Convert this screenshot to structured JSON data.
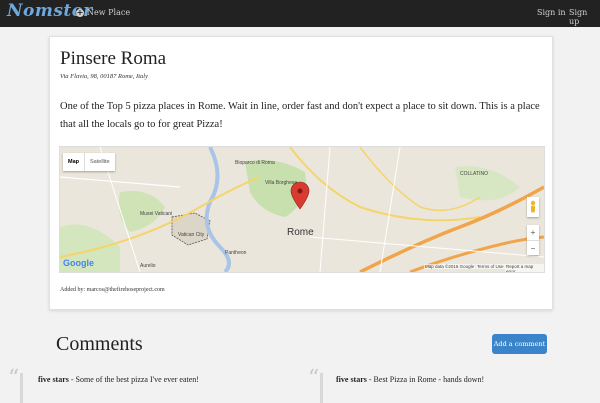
{
  "navbar": {
    "brand": "Nomster",
    "new_place": "New Place",
    "sign_in": "Sign in",
    "sign_up": "Sign up"
  },
  "place": {
    "name": "Pinsere Roma",
    "address": "Via Flavia, 98, 00187 Rome, Italy",
    "description": "One of the Top 5 pizza places in Rome. Wait in line, order fast and don't expect a place to sit down. This is a place that all the locals go to for great Pizza!",
    "added_by": "Added by: marcos@thefirehoseproject.com"
  },
  "map": {
    "type_map": "Map",
    "type_satellite": "Satellite",
    "city": "Rome",
    "labels": [
      "Bioparco di Roma",
      "Villa Borghese",
      "Musei Vaticani",
      "Vatican City",
      "Pantheon",
      "Aurelio",
      "COLLATINO"
    ],
    "google": "Google",
    "map_data": "Map data ©2016 Google",
    "terms": "Terms of Use",
    "report": "Report a map error",
    "zoom_in": "+",
    "zoom_out": "−"
  },
  "comments": {
    "title": "Comments",
    "add_label": "Add a comment",
    "items": [
      {
        "rating": "five stars",
        "text": " - Some of the best pizza I've ever eaten!"
      },
      {
        "rating": "five stars",
        "text": " - Best Pizza in Rome - hands down!"
      }
    ]
  },
  "colors": {
    "navbar": "#222222",
    "brand": "#6fa8dc",
    "button": "#3a84c9",
    "map_pin": "#d93b30"
  }
}
